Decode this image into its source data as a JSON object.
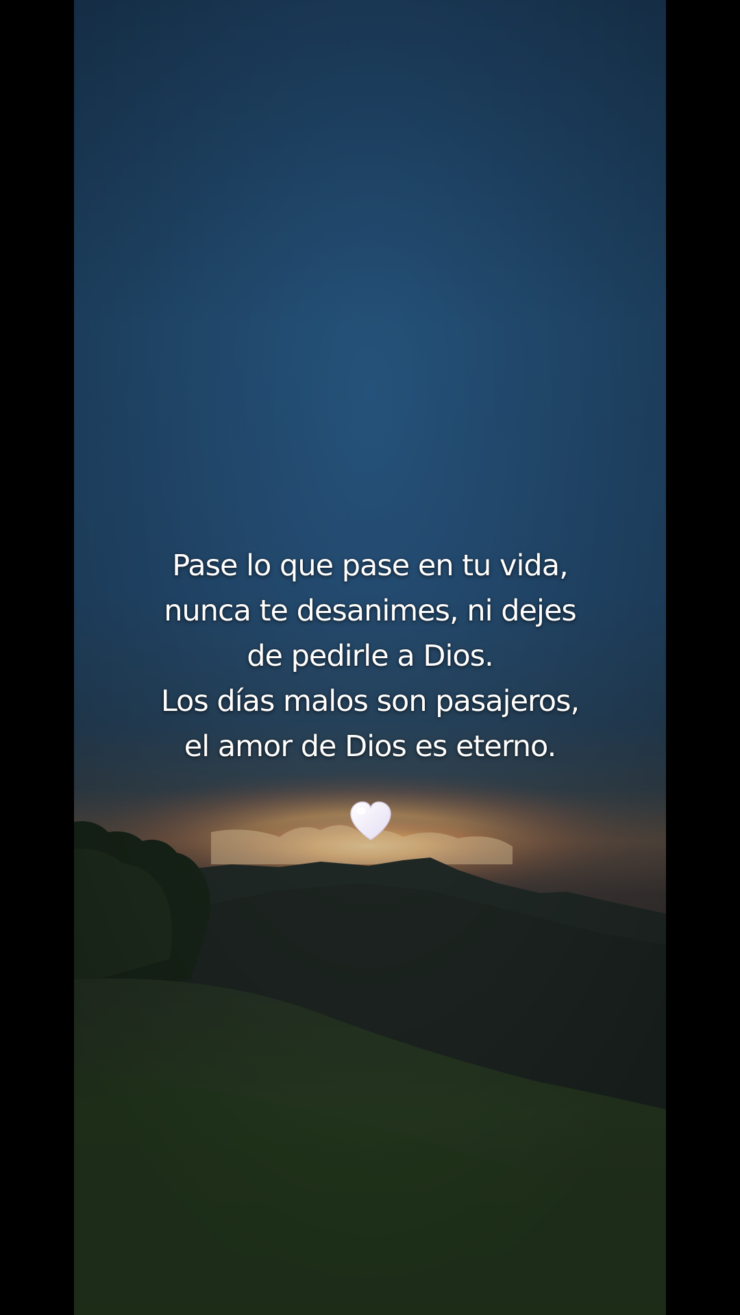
{
  "quote": {
    "lines": [
      "Pase lo que pase en tu vida,",
      "nunca te desanimes, ni dejes",
      "de pedirle a Dios.",
      "Los días malos son pasajeros,",
      "el amor de Dios es eterno."
    ],
    "emoji": "white-heart-icon"
  },
  "colors": {
    "sky_top": "#1f4467",
    "sky_mid": "#28587f",
    "sunset_glow": "#f2b46a",
    "hills": "#22302a",
    "grass": "#2d4226",
    "letterbox": "#000000"
  }
}
